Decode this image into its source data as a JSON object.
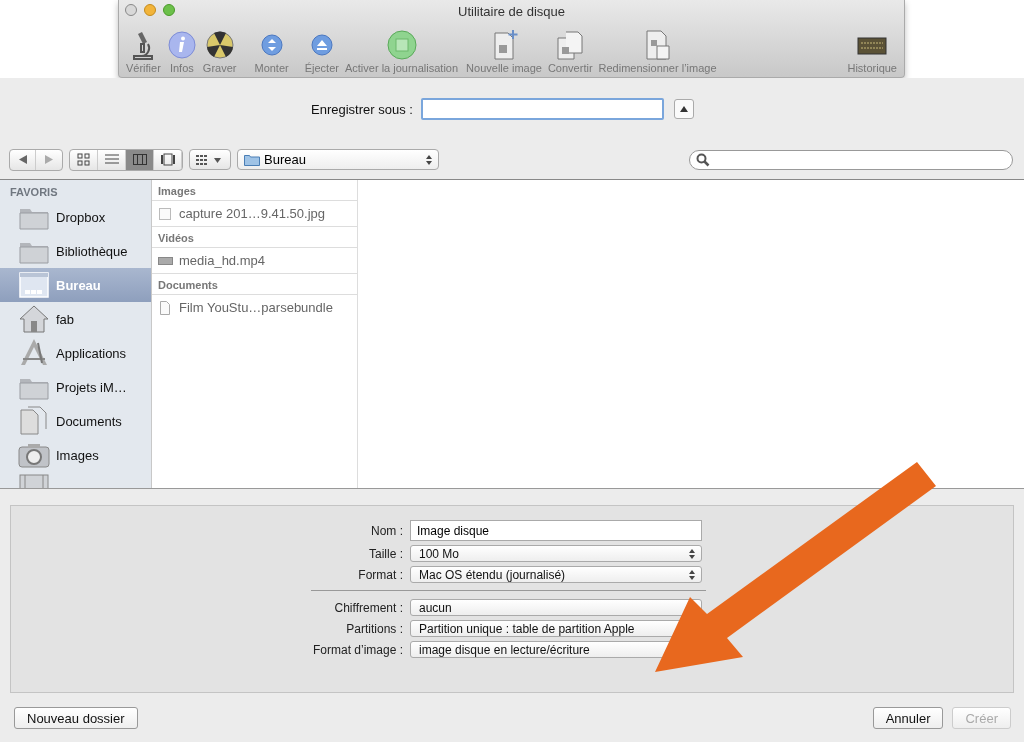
{
  "window": {
    "title": "Utilitaire de disque",
    "toolbar": [
      {
        "label": "Vérifier",
        "kind": "microscope"
      },
      {
        "label": "Infos",
        "kind": "info"
      },
      {
        "label": "Graver",
        "kind": "burn"
      },
      {
        "label": "Monter",
        "kind": "mount"
      },
      {
        "label": "Éjecter",
        "kind": "eject"
      },
      {
        "label": "Activer la journalisation",
        "kind": "journal"
      },
      {
        "label": "Nouvelle image",
        "kind": "new-image"
      },
      {
        "label": "Convertir",
        "kind": "convert"
      },
      {
        "label": "Redimensionner l’image",
        "kind": "resize"
      },
      {
        "label": "Historique",
        "kind": "log"
      }
    ]
  },
  "save_as": {
    "label": "Enregistrer sous :",
    "expanded": false
  },
  "view_modes": [
    {
      "kind": "icons",
      "selected": false
    },
    {
      "kind": "list",
      "selected": false
    },
    {
      "kind": "columns",
      "selected": true
    },
    {
      "kind": "coverflow",
      "selected": false
    }
  ],
  "location": "Bureau",
  "sidebar": {
    "header": "FAVORIS",
    "items": [
      {
        "label": "Dropbox",
        "kind": "folder",
        "selected": false
      },
      {
        "label": "Bibliothèque",
        "kind": "folder",
        "selected": false
      },
      {
        "label": "Bureau",
        "kind": "desktop",
        "selected": true
      },
      {
        "label": "fab",
        "kind": "home",
        "selected": false
      },
      {
        "label": "Applications",
        "kind": "apps",
        "selected": false
      },
      {
        "label": "Projets iM…",
        "kind": "folder",
        "selected": false
      },
      {
        "label": "Documents",
        "kind": "docs",
        "selected": false
      },
      {
        "label": "Images",
        "kind": "camera",
        "selected": false
      },
      {
        "kind": "film",
        "selected": false
      }
    ]
  },
  "column": [
    {
      "header": "Images",
      "files": [
        {
          "name": "capture 201…9.41.50.jpg",
          "kind": "image"
        }
      ]
    },
    {
      "header": "Vidéos",
      "files": [
        {
          "name": "media_hd.mp4",
          "kind": "video"
        }
      ]
    },
    {
      "header": "Documents",
      "files": [
        {
          "name": "Film YouStu…parsebundle",
          "kind": "doc"
        }
      ]
    }
  ],
  "options": {
    "groups": [
      [
        {
          "label": "Nom :",
          "value": "Image disque",
          "kind": "text"
        },
        {
          "label": "Taille :",
          "value": "100 Mo",
          "kind": "popup"
        },
        {
          "label": "Format :",
          "value": "Mac OS étendu (journalisé)",
          "kind": "popup"
        }
      ],
      [
        {
          "label": "Chiffrement :",
          "value": "aucun",
          "kind": "popup"
        },
        {
          "label": "Partitions :",
          "value": "Partition unique : table de partition Apple",
          "kind": "popup"
        },
        {
          "label": "Format d’image :",
          "value": "image disque en lecture/écriture",
          "kind": "popup"
        }
      ]
    ]
  },
  "left_buttons": [
    {
      "label": "Nouveau dossier",
      "disabled": false
    }
  ],
  "right_buttons": [
    {
      "label": "Annuler",
      "disabled": false
    },
    {
      "label": "Créer",
      "disabled": true
    }
  ]
}
